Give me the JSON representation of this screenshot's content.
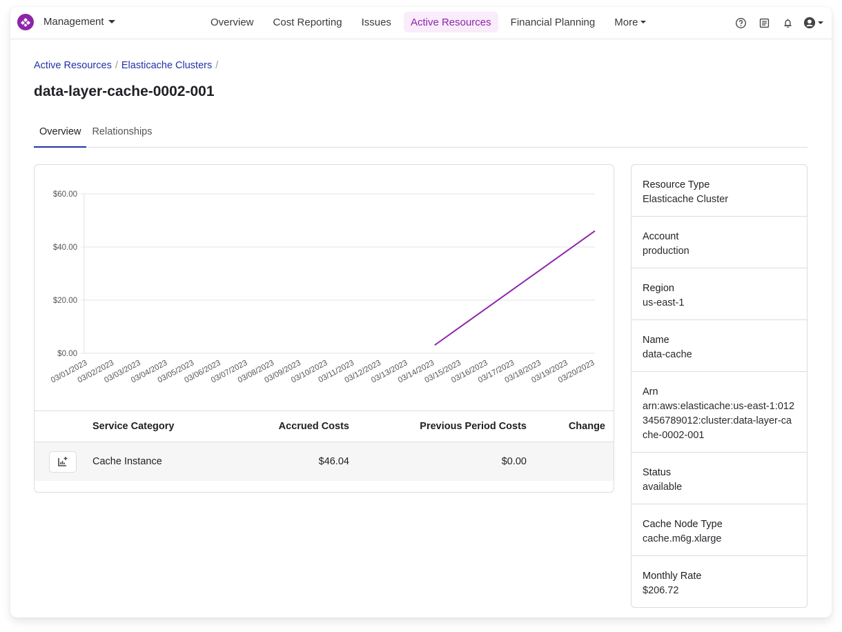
{
  "topbar": {
    "org_label": "Management",
    "nav": [
      {
        "label": "Overview",
        "active": false
      },
      {
        "label": "Cost Reporting",
        "active": false
      },
      {
        "label": "Issues",
        "active": false
      },
      {
        "label": "Active Resources",
        "active": true
      },
      {
        "label": "Financial Planning",
        "active": false
      },
      {
        "label": "More",
        "active": false
      }
    ],
    "icons": [
      "help-icon",
      "docs-icon",
      "bell-icon",
      "user-icon"
    ],
    "accent_color": "#8e24aa"
  },
  "breadcrumb": [
    {
      "label": "Active Resources"
    },
    {
      "label": "Elasticache Clusters"
    }
  ],
  "breadcrumb_separator": "/",
  "page_title": "data-layer-cache-0002-001",
  "tabs": [
    {
      "label": "Overview",
      "active": true
    },
    {
      "label": "Relationships",
      "active": false
    }
  ],
  "chart_data": {
    "type": "line",
    "title": "",
    "xlabel": "",
    "ylabel": "",
    "x": [
      "03/01/2023",
      "03/02/2023",
      "03/03/2023",
      "03/04/2023",
      "03/05/2023",
      "03/06/2023",
      "03/07/2023",
      "03/08/2023",
      "03/09/2023",
      "03/10/2023",
      "03/11/2023",
      "03/12/2023",
      "03/13/2023",
      "03/14/2023",
      "03/15/2023",
      "03/16/2023",
      "03/17/2023",
      "03/18/2023",
      "03/19/2023",
      "03/20/2023"
    ],
    "series": [
      {
        "name": "Cache Instance",
        "color": "#8e24aa",
        "values": [
          null,
          null,
          null,
          null,
          null,
          null,
          null,
          null,
          null,
          null,
          null,
          null,
          null,
          3.07,
          10.23,
          17.39,
          24.55,
          31.72,
          38.88,
          46.04
        ]
      }
    ],
    "ylim": [
      0,
      60
    ],
    "yticks": [
      0,
      20,
      40,
      60
    ],
    "ytick_labels": [
      "$0.00",
      "$20.00",
      "$40.00",
      "$60.00"
    ],
    "grid": true,
    "legend": "none"
  },
  "table": {
    "headers": [
      "",
      "Service Category",
      "Accrued Costs",
      "Previous Period Costs",
      "Change"
    ],
    "rows": [
      {
        "category": "Cache Instance",
        "accrued": "$46.04",
        "previous": "$0.00",
        "change": ""
      }
    ]
  },
  "properties": [
    {
      "label": "Resource Type",
      "value": "Elasticache Cluster"
    },
    {
      "label": "Account",
      "value": "production"
    },
    {
      "label": "Region",
      "value": "us-east-1"
    },
    {
      "label": "Name",
      "value": "data-cache"
    },
    {
      "label": "Arn",
      "value": "arn:aws:elasticache:us-east-1:0123456789012:cluster:data-layer-cache-0002-001"
    },
    {
      "label": "Status",
      "value": "available"
    },
    {
      "label": "Cache Node Type",
      "value": "cache.m6g.xlarge"
    },
    {
      "label": "Monthly Rate",
      "value": "$206.72"
    }
  ]
}
